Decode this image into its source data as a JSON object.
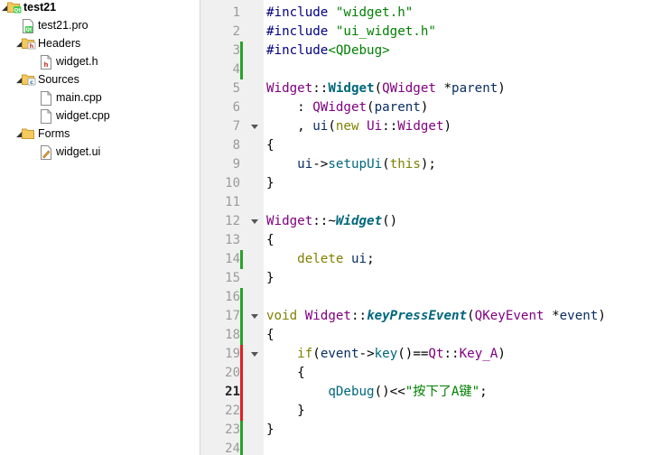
{
  "project_tree": {
    "items": [
      {
        "id": "root",
        "label": "test21",
        "icon": "qt-project-icon",
        "expandable": true,
        "expanded": true,
        "depth": 0,
        "bold": true
      },
      {
        "id": "pro",
        "label": "test21.pro",
        "icon": "pro-file-icon",
        "expandable": false,
        "depth": 1
      },
      {
        "id": "headers",
        "label": "Headers",
        "icon": "header-folder-icon",
        "expandable": true,
        "expanded": true,
        "depth": 1
      },
      {
        "id": "widget_h",
        "label": "widget.h",
        "icon": "header-file-icon",
        "expandable": false,
        "depth": 2
      },
      {
        "id": "sources",
        "label": "Sources",
        "icon": "source-folder-icon",
        "expandable": true,
        "expanded": true,
        "depth": 1
      },
      {
        "id": "main_cpp",
        "label": "main.cpp",
        "icon": "cpp-file-icon",
        "expandable": false,
        "depth": 2
      },
      {
        "id": "widget_cpp",
        "label": "widget.cpp",
        "icon": "cpp-file-icon",
        "expandable": false,
        "depth": 2
      },
      {
        "id": "forms",
        "label": "Forms",
        "icon": "forms-folder-icon",
        "expandable": true,
        "expanded": true,
        "depth": 1
      },
      {
        "id": "widget_ui",
        "label": "widget.ui",
        "icon": "ui-file-icon",
        "expandable": false,
        "depth": 2
      }
    ]
  },
  "editor": {
    "current_line": 21,
    "lines": [
      {
        "n": "1",
        "change": "",
        "fold": false,
        "tokens": [
          [
            "pp",
            "#include "
          ],
          [
            "str",
            "\"widget.h\""
          ]
        ]
      },
      {
        "n": "2",
        "change": "",
        "fold": false,
        "tokens": [
          [
            "pp",
            "#include "
          ],
          [
            "str",
            "\"ui_widget.h\""
          ]
        ]
      },
      {
        "n": "3",
        "change": "add",
        "fold": false,
        "tokens": [
          [
            "pp",
            "#include"
          ],
          [
            "inc",
            "<QDebug>"
          ]
        ]
      },
      {
        "n": "4",
        "change": "add",
        "fold": false,
        "tokens": []
      },
      {
        "n": "5",
        "change": "",
        "fold": false,
        "tokens": [
          [
            "cls",
            "Widget"
          ],
          [
            "plain",
            "::"
          ],
          [
            "fnb",
            "Widget"
          ],
          [
            "plain",
            "("
          ],
          [
            "cls",
            "QWidget"
          ],
          [
            "plain",
            " *"
          ],
          [
            "var",
            "parent"
          ],
          [
            "plain",
            ")"
          ]
        ]
      },
      {
        "n": "6",
        "change": "",
        "fold": false,
        "tokens": [
          [
            "plain",
            "    : "
          ],
          [
            "cls",
            "QWidget"
          ],
          [
            "plain",
            "("
          ],
          [
            "var",
            "parent"
          ],
          [
            "plain",
            ")"
          ]
        ]
      },
      {
        "n": "7",
        "change": "",
        "fold": true,
        "tokens": [
          [
            "plain",
            "    , "
          ],
          [
            "var",
            "ui"
          ],
          [
            "plain",
            "("
          ],
          [
            "kw",
            "new"
          ],
          [
            "plain",
            " "
          ],
          [
            "cls",
            "Ui"
          ],
          [
            "plain",
            "::"
          ],
          [
            "cls",
            "Widget"
          ],
          [
            "plain",
            ")"
          ]
        ]
      },
      {
        "n": "8",
        "change": "",
        "fold": false,
        "tokens": [
          [
            "plain",
            "{"
          ]
        ]
      },
      {
        "n": "9",
        "change": "",
        "fold": false,
        "tokens": [
          [
            "plain",
            "    "
          ],
          [
            "var",
            "ui"
          ],
          [
            "plain",
            "->"
          ],
          [
            "fn",
            "setupUi"
          ],
          [
            "plain",
            "("
          ],
          [
            "kw",
            "this"
          ],
          [
            "plain",
            ");"
          ]
        ]
      },
      {
        "n": "10",
        "change": "",
        "fold": false,
        "tokens": [
          [
            "plain",
            "}"
          ]
        ]
      },
      {
        "n": "11",
        "change": "",
        "fold": false,
        "tokens": []
      },
      {
        "n": "12",
        "change": "",
        "fold": true,
        "tokens": [
          [
            "cls",
            "Widget"
          ],
          [
            "plain",
            "::~"
          ],
          [
            "fnbi",
            "Widget"
          ],
          [
            "plain",
            "()"
          ]
        ]
      },
      {
        "n": "13",
        "change": "",
        "fold": false,
        "tokens": [
          [
            "plain",
            "{"
          ]
        ]
      },
      {
        "n": "14",
        "change": "add",
        "fold": false,
        "tokens": [
          [
            "plain",
            "    "
          ],
          [
            "kw",
            "delete"
          ],
          [
            "plain",
            " "
          ],
          [
            "var",
            "ui"
          ],
          [
            "plain",
            ";"
          ]
        ]
      },
      {
        "n": "15",
        "change": "",
        "fold": false,
        "tokens": [
          [
            "plain",
            "}"
          ]
        ]
      },
      {
        "n": "16",
        "change": "add",
        "fold": false,
        "tokens": []
      },
      {
        "n": "17",
        "change": "add",
        "fold": true,
        "tokens": [
          [
            "kw",
            "void"
          ],
          [
            "plain",
            " "
          ],
          [
            "cls",
            "Widget"
          ],
          [
            "plain",
            "::"
          ],
          [
            "fnbi",
            "keyPressEvent"
          ],
          [
            "plain",
            "("
          ],
          [
            "cls",
            "QKeyEvent"
          ],
          [
            "plain",
            " *"
          ],
          [
            "var",
            "event"
          ],
          [
            "plain",
            ")"
          ]
        ]
      },
      {
        "n": "18",
        "change": "add",
        "fold": false,
        "tokens": [
          [
            "plain",
            "{"
          ]
        ]
      },
      {
        "n": "19",
        "change": "mod",
        "fold": true,
        "tokens": [
          [
            "plain",
            "    "
          ],
          [
            "kw",
            "if"
          ],
          [
            "plain",
            "("
          ],
          [
            "var",
            "event"
          ],
          [
            "plain",
            "->"
          ],
          [
            "fn",
            "key"
          ],
          [
            "plain",
            "()=="
          ],
          [
            "cls",
            "Qt"
          ],
          [
            "plain",
            "::"
          ],
          [
            "cls",
            "Key_A"
          ],
          [
            "plain",
            ")"
          ]
        ]
      },
      {
        "n": "20",
        "change": "mod",
        "fold": false,
        "tokens": [
          [
            "plain",
            "    {"
          ]
        ]
      },
      {
        "n": "21",
        "change": "mod",
        "fold": false,
        "tokens": [
          [
            "plain",
            "        "
          ],
          [
            "fn",
            "qDebug"
          ],
          [
            "plain",
            "()<<"
          ],
          [
            "str",
            "\"按下了A键\""
          ],
          [
            "plain",
            ";"
          ]
        ]
      },
      {
        "n": "22",
        "change": "mod",
        "fold": false,
        "tokens": [
          [
            "plain",
            "    }"
          ]
        ]
      },
      {
        "n": "23",
        "change": "add",
        "fold": false,
        "tokens": [
          [
            "plain",
            "}"
          ]
        ]
      },
      {
        "n": "24",
        "change": "add",
        "fold": false,
        "tokens": []
      }
    ]
  },
  "colors": {
    "gutter_bg": "#f0f0f0",
    "added_marker": "#27a327",
    "modified_marker": "#e02020"
  }
}
